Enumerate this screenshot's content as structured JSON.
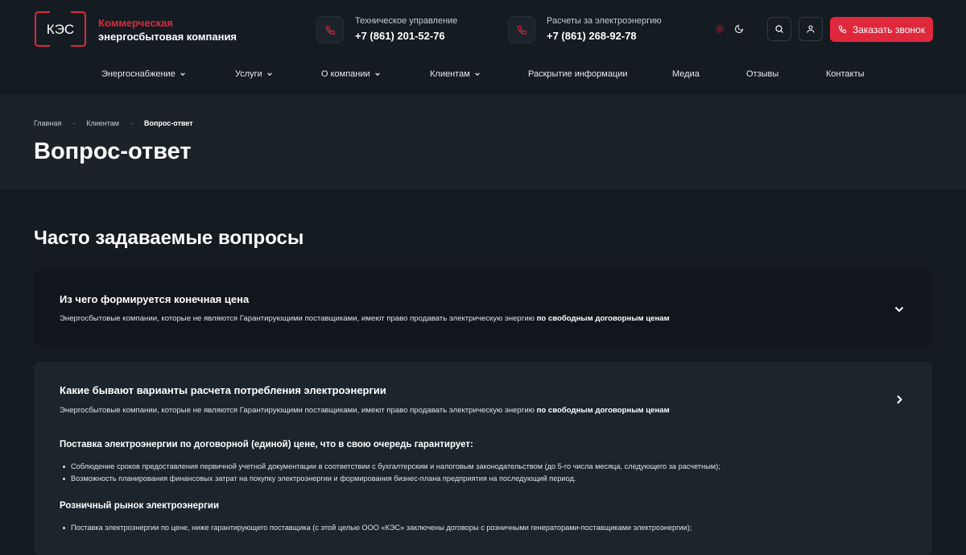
{
  "header": {
    "logo_text": "КЭС",
    "brand_line1": "Коммерческая",
    "brand_line2": "энергосбытовая компания",
    "contacts": [
      {
        "label": "Техническое управление",
        "phone": "+7 (861) 201-52-76"
      },
      {
        "label": "Расчеты за электроэнергию",
        "phone": "+7 (861) 268-92-78"
      }
    ],
    "call_button": "Заказать звонок"
  },
  "nav": [
    {
      "label": "Энергоснабжение",
      "has_dropdown": true
    },
    {
      "label": "Услуги",
      "has_dropdown": true
    },
    {
      "label": "О компании",
      "has_dropdown": true
    },
    {
      "label": "Клиентам",
      "has_dropdown": true
    },
    {
      "label": "Раскрытие информации",
      "has_dropdown": false
    },
    {
      "label": "Медиа",
      "has_dropdown": false
    },
    {
      "label": "Отзывы",
      "has_dropdown": false
    },
    {
      "label": "Контакты",
      "has_dropdown": false
    }
  ],
  "breadcrumb": [
    "Главная",
    "Клиентам",
    "Вопрос-ответ"
  ],
  "page_title": "Вопрос-ответ",
  "faq": {
    "heading": "Часто задаваемые вопросы",
    "items": [
      {
        "title": "Из чего формируется конечная цена",
        "text": "Энергосбытовые компании, которые не являются Гарантирующими поставщиками, имеют право продавать электрическую энергию",
        "text_bold": "по свободным договорным ценам"
      },
      {
        "title": "Какие бывают варианты расчета потребления электроэнергии",
        "text": "Энергосбытовые компании, которые не являются Гарантирующими поставщиками, имеют право продавать электрическую энергию",
        "text_bold": "по свободным договорным ценам",
        "sections": [
          {
            "heading": "Поставка электроэнергии по договорной (единой) цене, что в свою очередь гарантирует:",
            "bullets": [
              "Соблюдение сроков предоставления первичной учетной документации в соответствии с бухгалтерским и налоговым законодательством (до 5-го числа месяца, следующего за расчетным);",
              "Возможность планирования финансовых затрат на покупку электроэнергии и формирования бизнес-плана предприятия на последующий период."
            ]
          },
          {
            "heading": "Розничный рынок электроэнергии",
            "bullets": [
              "Поставка электроэнергии по цене, ниже гарантирующего поставщика (с этой целью ООО «КЭС» заключены договоры с розничными генераторами-поставщиками электроэнергии);"
            ]
          }
        ]
      }
    ]
  },
  "colors": {
    "accent": "#e0283d",
    "background": "#141b21",
    "band": "#1b2329",
    "card_dark": "#10161b",
    "card_light": "#1c252b"
  }
}
